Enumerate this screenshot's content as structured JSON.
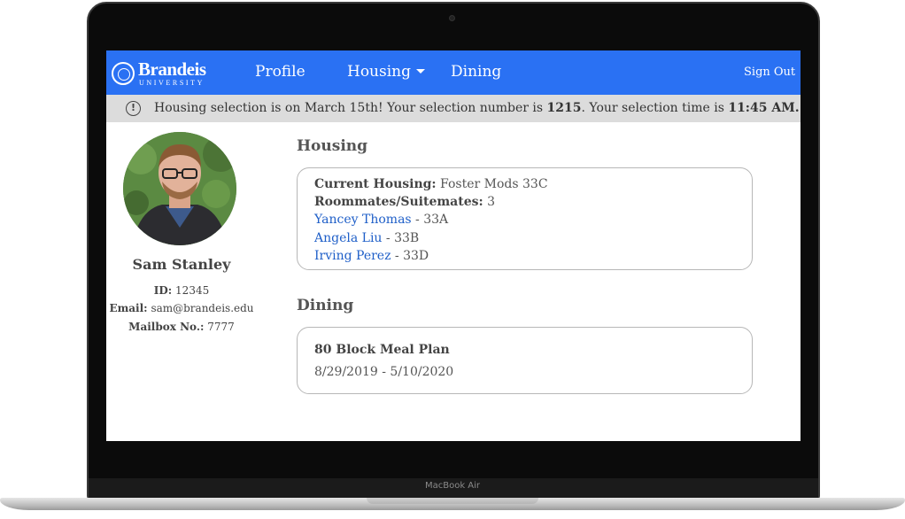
{
  "device": {
    "label": "MacBook Air"
  },
  "navbar": {
    "logo_name": "Brandeis",
    "logo_sub": "UNIVERSITY",
    "links": {
      "profile": "Profile",
      "housing": "Housing",
      "dining": "Dining"
    },
    "sign_out": "Sign Out",
    "accent_color": "#2a71f3"
  },
  "alert": {
    "prefix": "Housing selection is on March 15th! Your selection number is ",
    "selection_number": "1215",
    "middle": ". Your selection time is ",
    "selection_time": "11:45 AM.",
    "icon": "exclamation-circle-icon"
  },
  "profile": {
    "name": "Sam Stanley",
    "id_label": "ID:",
    "id_value": "12345",
    "email_label": "Email:",
    "email_value": "sam@brandeis.edu",
    "mailbox_label": "Mailbox No.:",
    "mailbox_value": "7777"
  },
  "housing": {
    "title": "Housing",
    "current_label": "Current Housing:",
    "current_value": "Foster Mods 33C",
    "roommates_label": "Roommates/Suitemates:",
    "roommates_count": "3",
    "roommates": [
      {
        "name": "Yancey Thomas",
        "room": " - 33A"
      },
      {
        "name": "Angela Liu",
        "room": " - 33B"
      },
      {
        "name": "Irving Perez",
        "room": " - 33D"
      }
    ]
  },
  "dining": {
    "title": "Dining",
    "plan": "80 Block Meal Plan",
    "dates": "8/29/2019 - 5/10/2020"
  }
}
